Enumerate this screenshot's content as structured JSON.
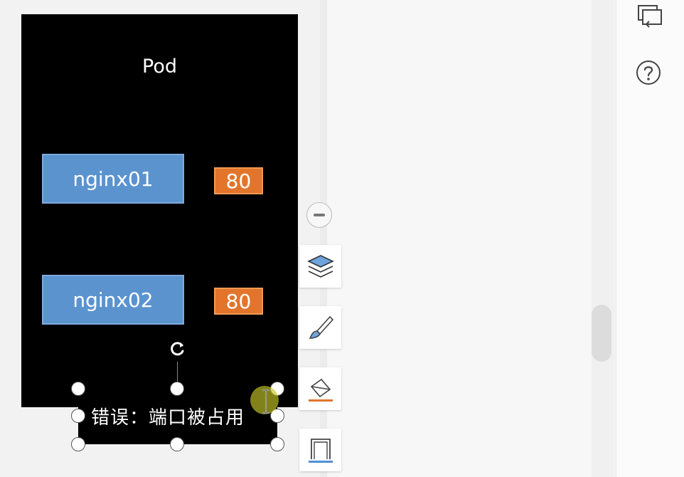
{
  "slide": {
    "title": "Pod",
    "containers": [
      {
        "name": "nginx01",
        "port": "80"
      },
      {
        "name": "nginx02",
        "port": "80"
      }
    ],
    "error_text": "错误：端口被占用"
  },
  "colors": {
    "slide_background": "#000000",
    "container_fill": "#5b93cf",
    "port_fill": "#e2752b",
    "fill_underline": "#e2752b",
    "outline_underline": "#4f8fd4"
  },
  "icons": {
    "zoom_out": "minus-circle-icon",
    "layers": "layers-icon",
    "style_brush": "brush-icon",
    "fill": "paint-bucket-icon",
    "outline": "shape-outline-icon",
    "present": "present-icon",
    "help": "help-icon",
    "rotate": "rotate-icon"
  }
}
